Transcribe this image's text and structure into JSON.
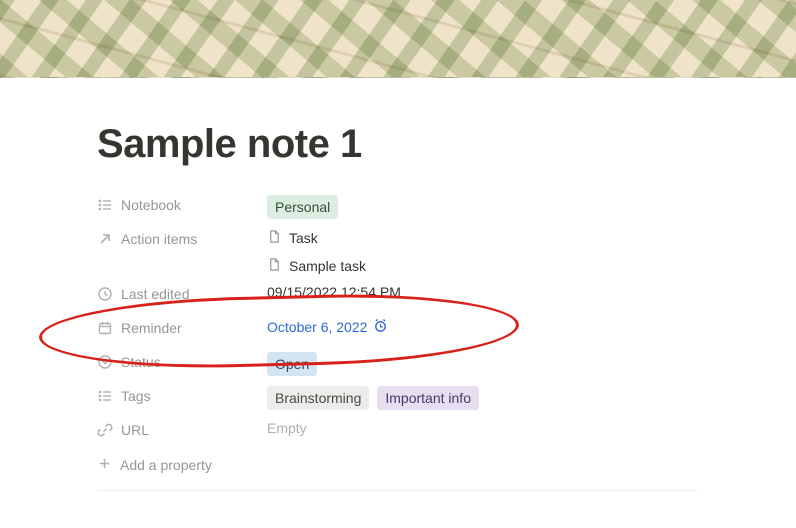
{
  "title": "Sample note 1",
  "properties": {
    "notebook": {
      "label": "Notebook",
      "tag": "Personal"
    },
    "action_items": {
      "label": "Action items",
      "items": [
        "Task",
        "Sample task"
      ]
    },
    "last_edited": {
      "label": "Last edited",
      "value": "09/15/2022 12:54 PM"
    },
    "reminder": {
      "label": "Reminder",
      "value": "October 6, 2022"
    },
    "status": {
      "label": "Status",
      "tag": "Open"
    },
    "tags": {
      "label": "Tags",
      "items": [
        "Brainstorming",
        "Important info"
      ]
    },
    "url": {
      "label": "URL",
      "value": "Empty"
    }
  },
  "add_property_label": "Add a property"
}
